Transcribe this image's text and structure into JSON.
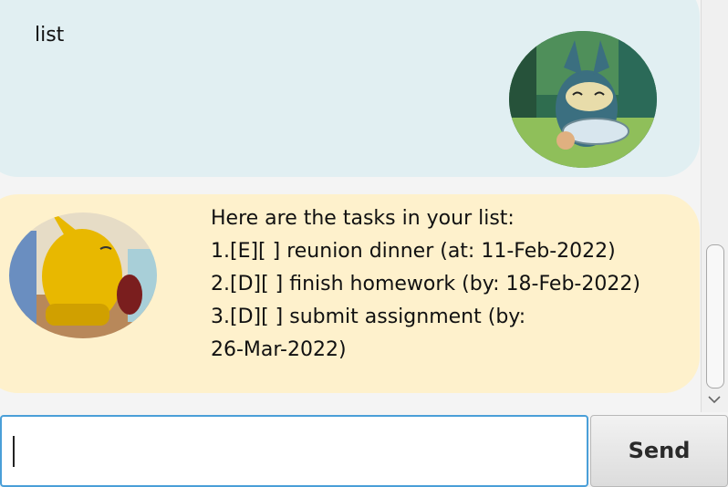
{
  "chat": {
    "user_message": {
      "text": "list",
      "avatar_icon": "munchlax-avatar-icon"
    },
    "bot_message": {
      "avatar_icon": "pikachu-avatar-icon",
      "lines": [
        "Here are the tasks in your list:",
        "1.[E][ ] reunion dinner (at: 11-Feb-2022)",
        "2.[D][ ] finish homework (by: 18-Feb-2022)",
        "3.[D][ ] submit assignment (by:",
        "26-Mar-2022)"
      ]
    }
  },
  "input": {
    "value": "",
    "placeholder": ""
  },
  "send_button": {
    "label": "Send"
  },
  "colors": {
    "user_bubble": "#e1eff2",
    "bot_bubble": "#fef1cc",
    "input_focus_border": "#4a9fd8"
  },
  "icons": {
    "scroll_down": "chevron-down-icon"
  }
}
